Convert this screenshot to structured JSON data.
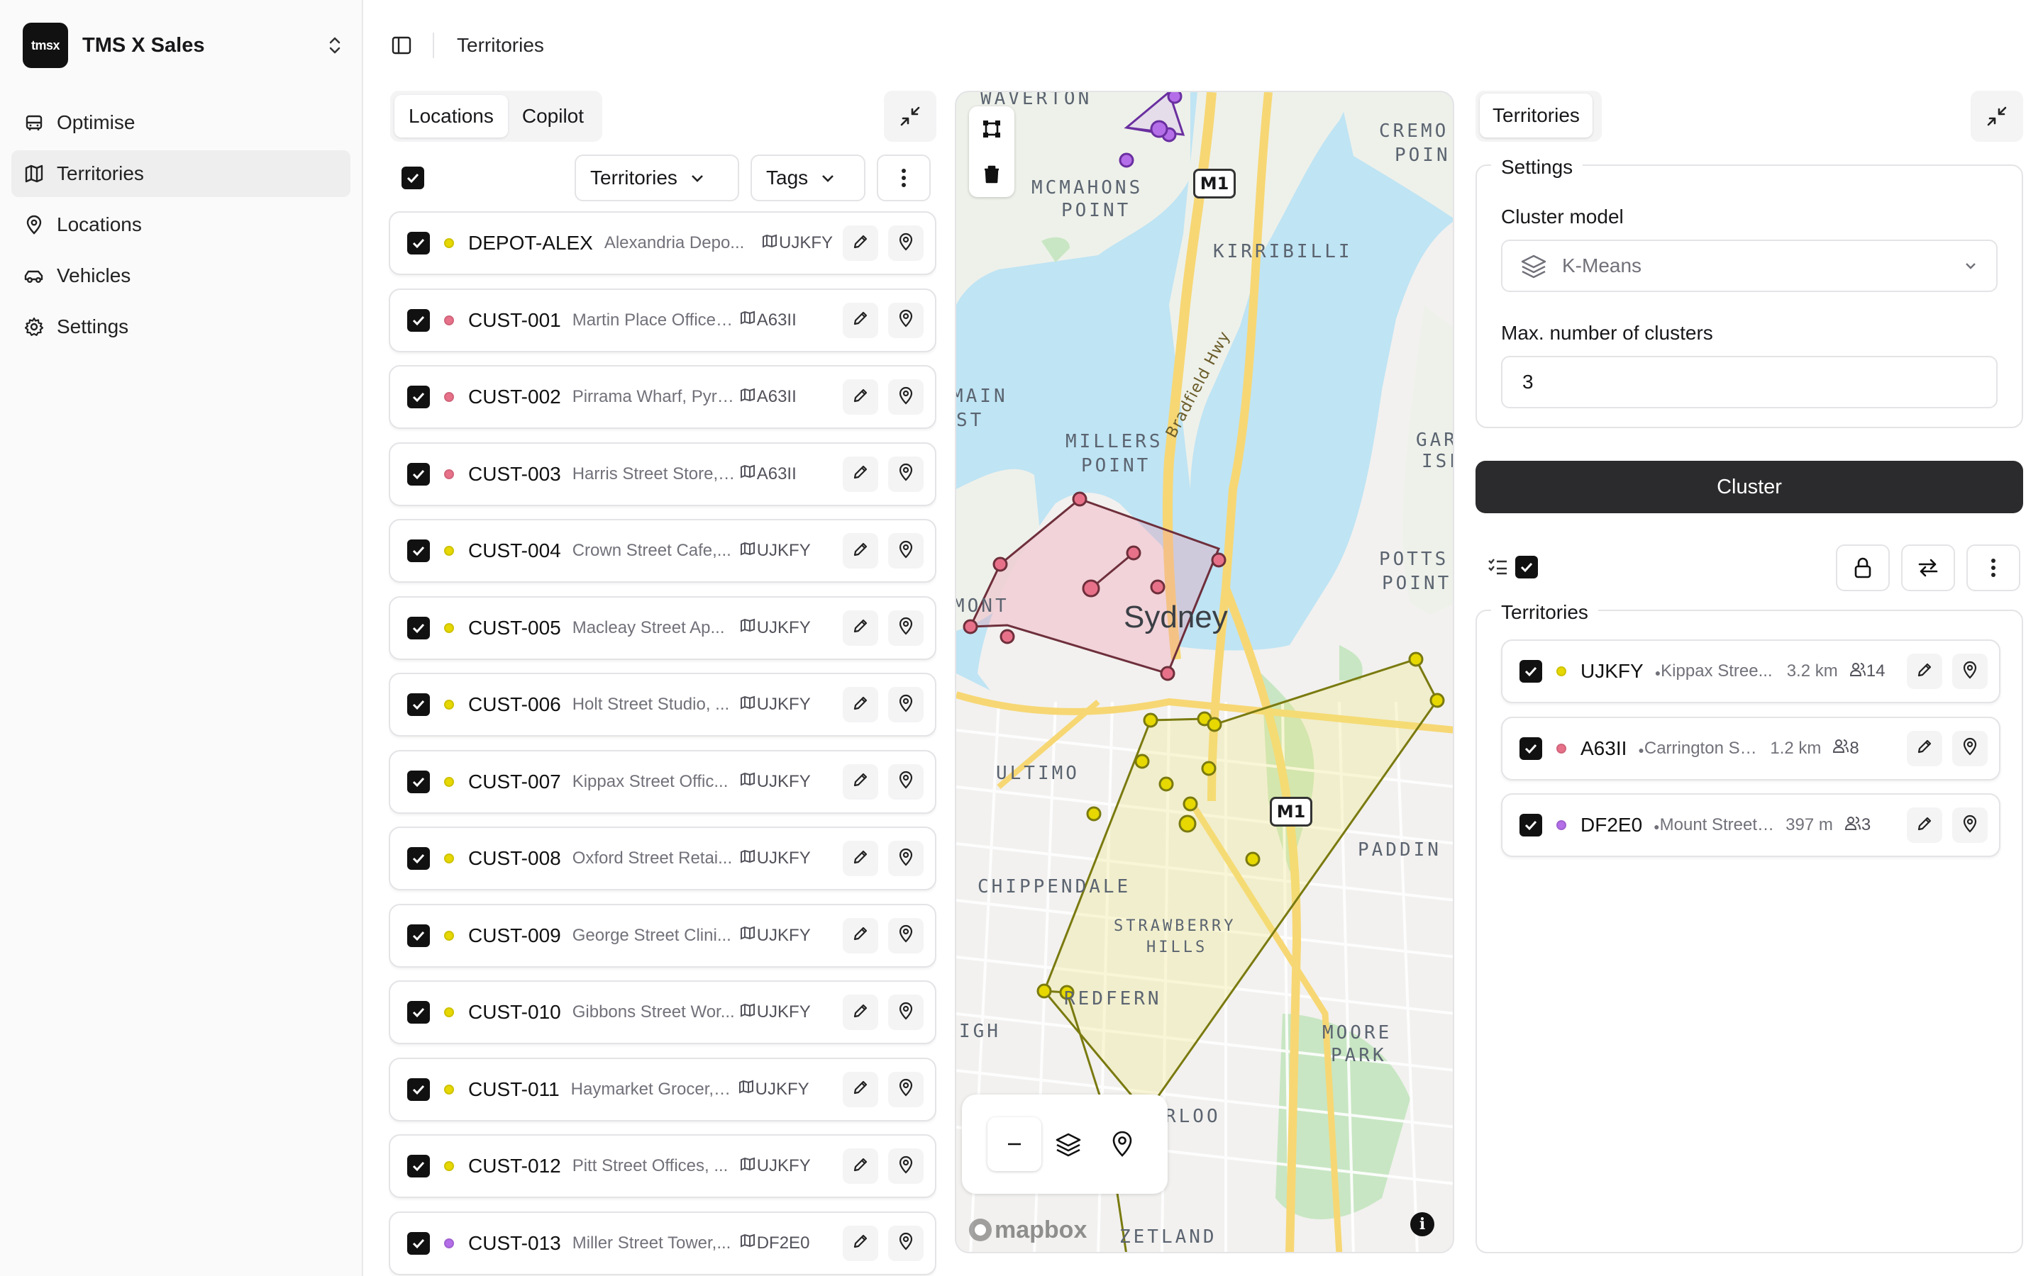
{
  "org": {
    "logo_text": "tmsx",
    "name": "TMS X Sales"
  },
  "nav": [
    {
      "label": "Optimise",
      "icon": "bus-icon",
      "active": false
    },
    {
      "label": "Territories",
      "icon": "map-icon",
      "active": true
    },
    {
      "label": "Locations",
      "icon": "map-pin-icon",
      "active": false
    },
    {
      "label": "Vehicles",
      "icon": "car-icon",
      "active": false
    },
    {
      "label": "Settings",
      "icon": "gear-icon",
      "active": false
    }
  ],
  "header": {
    "title": "Territories"
  },
  "locations_panel": {
    "tabs": [
      "Locations",
      "Copilot"
    ],
    "active_tab": "Locations",
    "filters": {
      "territories_label": "Territories",
      "tags_label": "Tags"
    },
    "items": [
      {
        "id": "DEPOT-ALEX",
        "address": "Alexandria Depo...",
        "territory": "UJKFY",
        "color": "#e6d800"
      },
      {
        "id": "CUST-001",
        "address": "Martin Place Office, ...",
        "territory": "A63II",
        "color": "#e8718a"
      },
      {
        "id": "CUST-002",
        "address": "Pirrama Wharf, Pyrm...",
        "territory": "A63II",
        "color": "#e8718a"
      },
      {
        "id": "CUST-003",
        "address": "Harris Street Store, ...",
        "territory": "A63II",
        "color": "#e8718a"
      },
      {
        "id": "CUST-004",
        "address": "Crown Street Cafe,...",
        "territory": "UJKFY",
        "color": "#e6d800"
      },
      {
        "id": "CUST-005",
        "address": "Macleay Street Ap...",
        "territory": "UJKFY",
        "color": "#e6d800"
      },
      {
        "id": "CUST-006",
        "address": "Holt Street Studio, ...",
        "territory": "UJKFY",
        "color": "#e6d800"
      },
      {
        "id": "CUST-007",
        "address": "Kippax Street Offic...",
        "territory": "UJKFY",
        "color": "#e6d800"
      },
      {
        "id": "CUST-008",
        "address": "Oxford Street Retai...",
        "territory": "UJKFY",
        "color": "#e6d800"
      },
      {
        "id": "CUST-009",
        "address": "George Street Clini...",
        "territory": "UJKFY",
        "color": "#e6d800"
      },
      {
        "id": "CUST-010",
        "address": "Gibbons Street Wor...",
        "territory": "UJKFY",
        "color": "#e6d800"
      },
      {
        "id": "CUST-011",
        "address": "Haymarket Grocer, H...",
        "territory": "UJKFY",
        "color": "#e6d800"
      },
      {
        "id": "CUST-012",
        "address": "Pitt Street Offices, ...",
        "territory": "UJKFY",
        "color": "#e6d800"
      },
      {
        "id": "CUST-013",
        "address": "Miller Street Tower,...",
        "territory": "DF2E0",
        "color": "#b36ee8"
      }
    ]
  },
  "map": {
    "suburbs": [
      "WAVERTON",
      "CREMO",
      "POIN",
      "MCMAHONS",
      "POINT",
      "KIRRIBILLI",
      "MAIN",
      "ST",
      "MILLERS",
      "POINT",
      "GAR",
      "ISLA",
      "POTTS",
      "POINT",
      "MONT",
      "ULTIMO",
      "PADDIN",
      "CHIPPENDALE",
      "STRAWBERRY",
      "HILLS",
      "REDFERN",
      "IGH",
      "MOORE",
      "PARK",
      "RLOO",
      "ZETLAND"
    ],
    "city": "Sydney",
    "road_label": "Bradfield Hwy",
    "shield": "M1",
    "attribution": "mapbox",
    "info": "i"
  },
  "territories_panel": {
    "tab": "Territories",
    "settings_legend": "Settings",
    "cluster_model_label": "Cluster model",
    "cluster_model_value": "K-Means",
    "max_clusters_label": "Max. number of clusters",
    "max_clusters_value": "3",
    "cluster_button": "Cluster",
    "territories_legend": "Territories",
    "items": [
      {
        "name": "UJKFY",
        "address": "Kippax Stree...",
        "distance": "3.2 km",
        "count": "14",
        "color": "#e6d800"
      },
      {
        "name": "A63II",
        "address": "Carrington Stre...",
        "distance": "1.2 km",
        "count": "8",
        "color": "#e8718a"
      },
      {
        "name": "DF2E0",
        "address": "Mount Street ...",
        "distance": "397 m",
        "count": "3",
        "color": "#b36ee8"
      }
    ]
  }
}
